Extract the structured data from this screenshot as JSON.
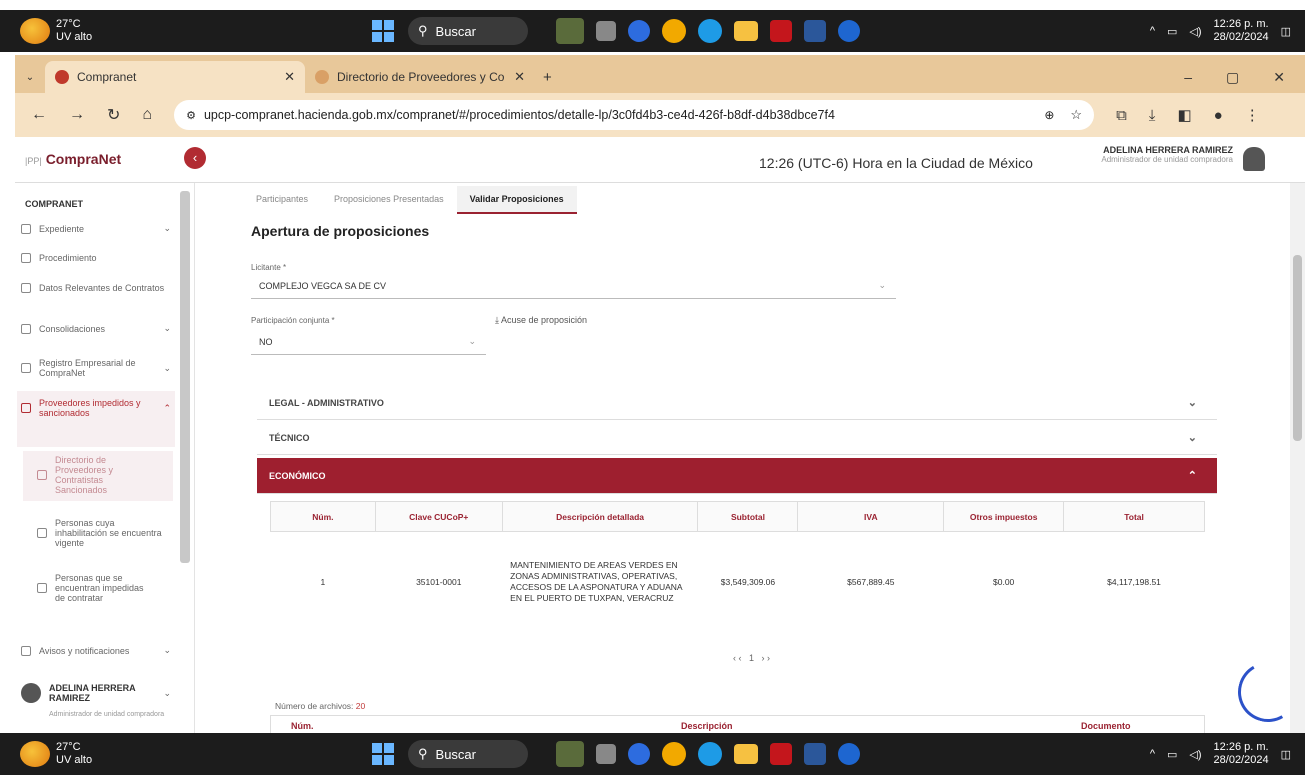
{
  "taskbar": {
    "temp": "27°C",
    "condition": "UV alto",
    "search": "Buscar",
    "time": "12:26 p. m.",
    "date": "28/02/2024"
  },
  "browser": {
    "tab1": "Compranet",
    "tab2": "Directorio de Proveedores y Co",
    "url": "upcp-compranet.hacienda.gob.mx/compranet/#/procedimientos/detalle-lp/3c0fd4b3-ce4d-426f-b8df-d4b38dbce7f4"
  },
  "header": {
    "logo": "CompraNet",
    "time": "12:26 (UTC-6) Hora en la Ciudad de México",
    "user_name": "ADELINA HERRERA RAMIREZ",
    "user_role": "Administrador de unidad compradora"
  },
  "sidebar": {
    "section": "COMPRANET",
    "items": [
      {
        "label": "Expediente"
      },
      {
        "label": "Procedimiento"
      },
      {
        "label": "Datos Relevantes de Contratos"
      },
      {
        "label": "Consolidaciones"
      },
      {
        "label": "Registro Empresarial de CompraNet"
      },
      {
        "label": "Proveedores impedidos y sancionados"
      },
      {
        "label": "Directorio de Proveedores y Contratistas Sancionados"
      },
      {
        "label": "Personas cuya inhabilitación se encuentra vigente"
      },
      {
        "label": "Personas que se encuentran impedidas de contratar"
      },
      {
        "label": "Avisos y notificaciones"
      }
    ],
    "user_name": "ADELINA HERRERA RAMIREZ",
    "user_role": "Administrador de unidad compradora"
  },
  "main": {
    "tabs": [
      "Participantes",
      "Proposiciones Presentadas",
      "Validar Proposiciones"
    ],
    "title": "Apertura de proposiciones",
    "licitante_label": "Licitante *",
    "licitante_value": "COMPLEJO VEGCA SA DE CV",
    "conjunta_label": "Participación conjunta *",
    "conjunta_value": "NO",
    "acuse": "Acuse de proposición",
    "sections": [
      "LEGAL - ADMINISTRATIVO",
      "TÉCNICO",
      "ECONÓMICO"
    ],
    "table_headers": [
      "Núm.",
      "Clave CUCoP+",
      "Descripción detallada",
      "Subtotal",
      "IVA",
      "Otros impuestos",
      "Total"
    ],
    "row": {
      "num": "1",
      "clave": "35101-0001",
      "desc": "MANTENIMIENTO DE AREAS VERDES EN ZONAS ADMINISTRATIVAS, OPERATIVAS, ACCESOS DE LA ASPONATURA Y ADUANA EN EL PUERTO DE TUXPAN, VERACRUZ",
      "subtotal": "$3,549,309.06",
      "iva": "$567,889.45",
      "otros": "$0.00",
      "total": "$4,117,198.51"
    },
    "page": "1",
    "archivos_label": "Número de archivos:",
    "archivos_count": "20",
    "t2_col1": "Núm.",
    "t2_col2": "Descripción",
    "t2_col3": "Documento"
  },
  "colors": {
    "accent": "#9e1f2f",
    "tabbar": "#e8c89a"
  }
}
